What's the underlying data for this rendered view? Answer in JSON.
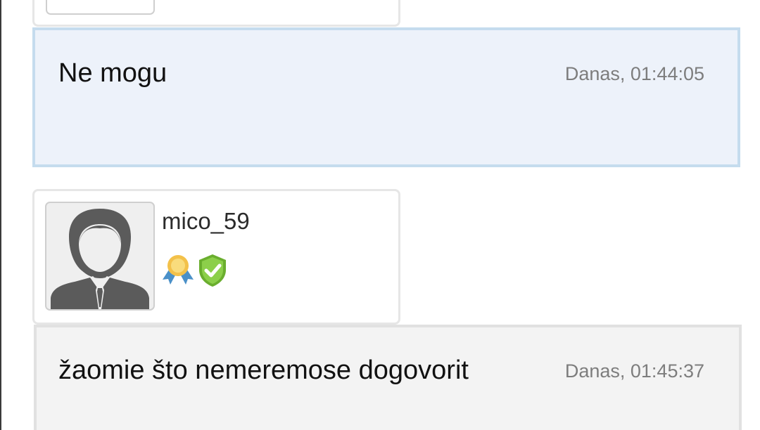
{
  "posts": [
    {
      "text": "Ne mogu",
      "time": "Danas, 01:44:05"
    },
    {
      "text": "žaomie što nemeremose dogovorit",
      "time": "Danas, 01:45:37"
    }
  ],
  "user": {
    "username": "mico_59",
    "avatar_icon": "default-male-avatar-icon",
    "badges": [
      "award-ribbon-icon",
      "verified-shield-icon"
    ]
  },
  "colors": {
    "post_highlight_bg": "#edf2fa",
    "post_highlight_border": "#c5dcee",
    "post_bg": "#f3f3f3",
    "timestamp": "#7d7d7d"
  }
}
